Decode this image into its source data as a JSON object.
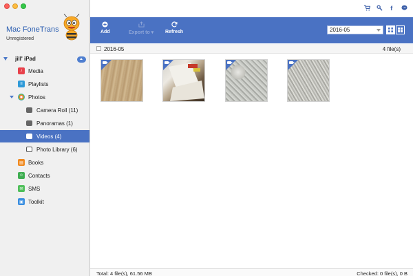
{
  "app": {
    "title": "Mac FoneTrans",
    "subtitle": "Unregistered"
  },
  "device": {
    "name": "jill' iPad"
  },
  "sidebar": {
    "items": [
      {
        "label": "Media",
        "icon": "music-note-icon",
        "color": "#e8404a"
      },
      {
        "label": "Playlists",
        "icon": "playlist-icon",
        "color": "#2f9ad8"
      },
      {
        "label": "Photos",
        "icon": "photos-flower-icon",
        "color": "#f0a020"
      },
      {
        "label": "Camera Roll (11)",
        "icon": "camera-icon",
        "color": "#555555"
      },
      {
        "label": "Panoramas (1)",
        "icon": "camera-icon",
        "color": "#555555"
      },
      {
        "label": "Videos (4)",
        "icon": "camera-icon",
        "color": "#555555"
      },
      {
        "label": "Photo Library (6)",
        "icon": "photo-library-icon",
        "color": "#555555"
      },
      {
        "label": "Books",
        "icon": "book-icon",
        "color": "#f08a20"
      },
      {
        "label": "Contacts",
        "icon": "contacts-icon",
        "color": "#3fae52"
      },
      {
        "label": "SMS",
        "icon": "message-icon",
        "color": "#4fbf5a"
      },
      {
        "label": "Toolkit",
        "icon": "toolkit-icon",
        "color": "#3a8ee0"
      }
    ]
  },
  "toolbar": {
    "add_label": "Add",
    "export_label": "Export to",
    "refresh_label": "Refresh",
    "date_value": "2016-05"
  },
  "group": {
    "date": "2016-05",
    "count": "4 file(s)"
  },
  "thumbnails": [
    "video-thumbnail-1",
    "video-thumbnail-2",
    "video-thumbnail-3",
    "video-thumbnail-4"
  ],
  "status": {
    "total": "Total: 4 file(s), 61.56 MB",
    "checked": "Checked: 0 file(s), 0 B"
  },
  "colors": {
    "accent": "#4a72c3"
  }
}
